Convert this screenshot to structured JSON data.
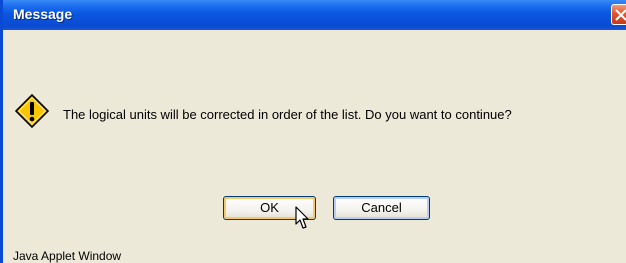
{
  "window": {
    "title": "Message",
    "footer": "Java Applet Window"
  },
  "dialog": {
    "message": "The logical units will be corrected in order of the list. Do you want to continue?",
    "icon": "warning-icon"
  },
  "buttons": {
    "ok_label": "OK",
    "cancel_label": "Cancel"
  },
  "colors": {
    "titlebar": "#0a57e0",
    "background": "#ece9d8",
    "warning": "#f7c600",
    "close": "#e0552d"
  }
}
